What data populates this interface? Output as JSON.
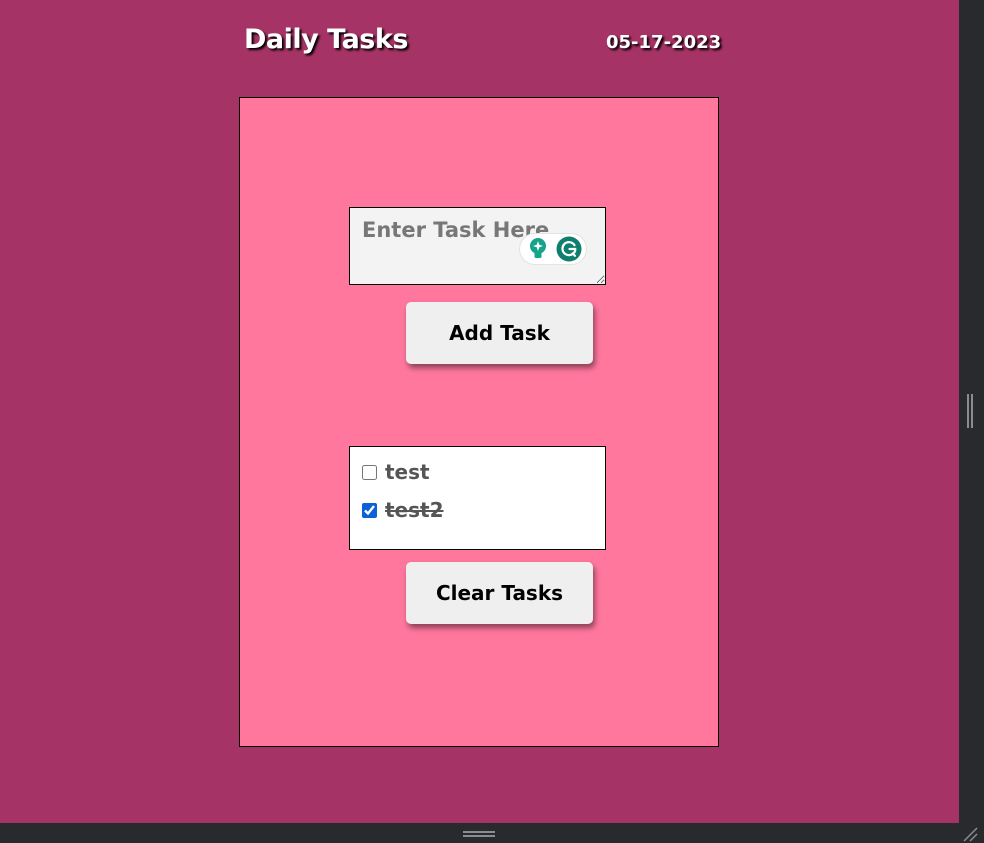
{
  "header": {
    "title": "Daily Tasks",
    "date": "05-17-2023"
  },
  "task_input": {
    "placeholder": "Enter Task Here",
    "value": ""
  },
  "buttons": {
    "add_label": "Add Task",
    "clear_label": "Clear Tasks"
  },
  "tasks": [
    {
      "label": "test",
      "checked": false
    },
    {
      "label": "test2",
      "checked": true
    }
  ],
  "icons": {
    "grammarly_suggestion": "lightbulb-icon",
    "grammarly_logo": "grammarly-g-icon",
    "right_resize": "vertical-grip-icon",
    "bottom_resize": "horizontal-grip-icon",
    "corner_resize": "resize-corner-icon"
  },
  "colors": {
    "page_background": "#a63366",
    "card_background": "#ff779d",
    "input_background": "#f3f3f3",
    "button_background": "#efefef",
    "grammarly_green": "#15a38b",
    "checkbox_accent": "#0b62d6"
  }
}
